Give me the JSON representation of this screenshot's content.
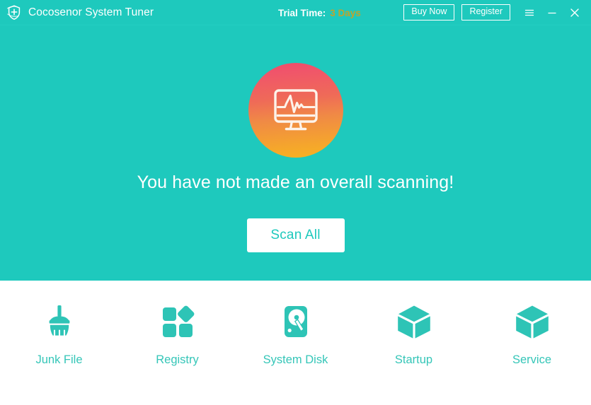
{
  "window": {
    "logo_icon": "shield-plus-logo-icon",
    "title": "Cocosenor System Tuner"
  },
  "titlebar": {
    "trial_label": "Trial Time:",
    "trial_value": "3 Days",
    "trial_value_color": "#bfa42c",
    "buy_now_label": "Buy Now",
    "register_label": "Register",
    "menu_icon": "hamburger-menu-icon",
    "minimize_icon": "minimize-icon",
    "close_icon": "close-icon"
  },
  "hero": {
    "icon": "monitor-pulse-icon",
    "circle_gradient_from": "#ef4a6b",
    "circle_gradient_to": "#f7b321",
    "headline": "You have not made an overall scanning!",
    "scan_button_label": "Scan All",
    "background_color": "#1ec9bd"
  },
  "tools": [
    {
      "icon": "broom-icon",
      "label": "Junk File"
    },
    {
      "icon": "registry-tiles-icon",
      "label": "Registry"
    },
    {
      "icon": "hard-disk-icon",
      "label": "System Disk"
    },
    {
      "icon": "cube-icon",
      "label": "Startup"
    },
    {
      "icon": "cube-icon",
      "label": "Service"
    }
  ],
  "theme": {
    "accent": "#1ec9bd",
    "tool_label_color": "#35c6b8"
  }
}
